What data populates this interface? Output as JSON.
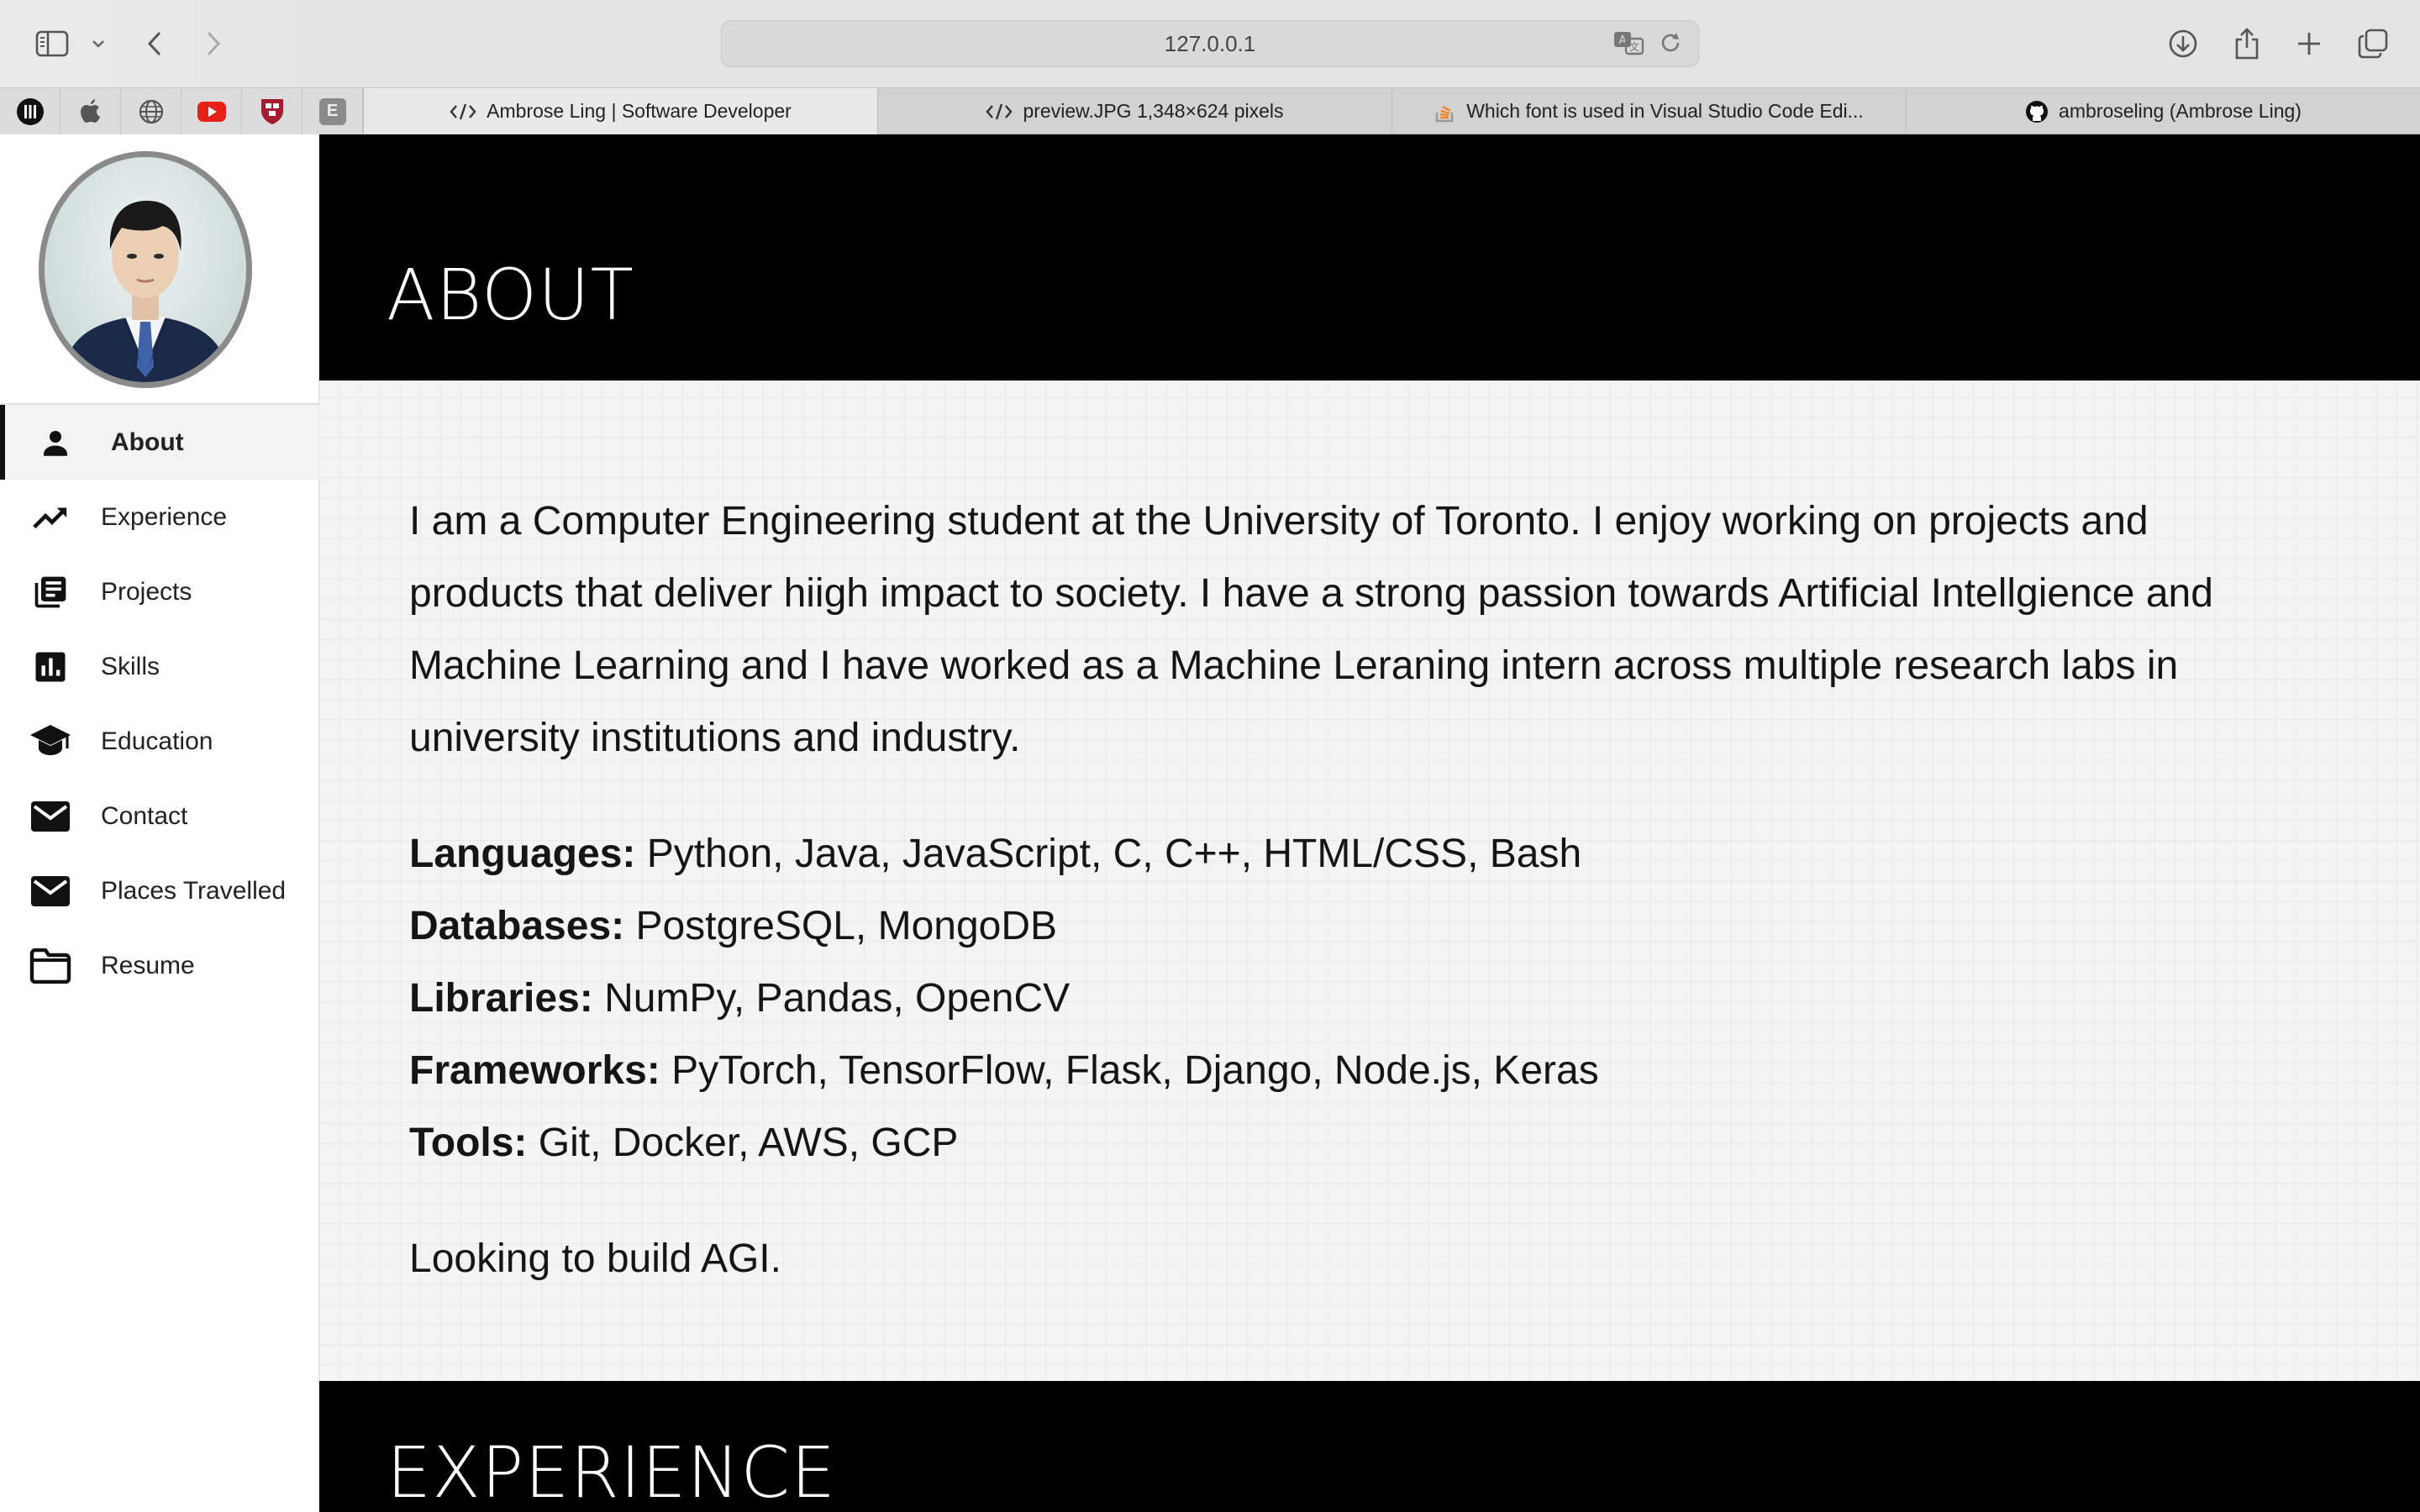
{
  "browser": {
    "url": "127.0.0.1",
    "tabs": [
      {
        "label": "Ambrose Ling | Software Developer",
        "icon": "code-icon",
        "active": true
      },
      {
        "label": "preview.JPG 1,348×624 pixels",
        "icon": "code-icon",
        "active": false
      },
      {
        "label": "Which font is used in Visual Studio Code Edi...",
        "icon": "stackoverflow-icon",
        "active": false
      },
      {
        "label": "ambroseling (Ambrose Ling)",
        "icon": "github-icon",
        "active": false
      }
    ],
    "favorites": [
      "podcast-icon",
      "apple-icon",
      "globe-icon",
      "youtube-icon",
      "harvard-shield-icon",
      "e-letter-icon"
    ],
    "favorite_letter": "E"
  },
  "sidebar": {
    "items": [
      {
        "label": "About",
        "icon": "person-icon",
        "active": true
      },
      {
        "label": "Experience",
        "icon": "trending-up-icon",
        "active": false
      },
      {
        "label": "Projects",
        "icon": "library-books-icon",
        "active": false
      },
      {
        "label": "Skills",
        "icon": "bar-chart-icon",
        "active": false
      },
      {
        "label": "Education",
        "icon": "graduation-cap-icon",
        "active": false
      },
      {
        "label": "Contact",
        "icon": "mail-icon",
        "active": false
      },
      {
        "label": "Places Travelled",
        "icon": "mail-icon",
        "active": false
      },
      {
        "label": "Resume",
        "icon": "folder-icon",
        "active": false
      }
    ]
  },
  "about": {
    "title": "ABOUT",
    "bio": "I am a Computer Engineering student at the University of Toronto. I enjoy working on projects and products that deliver hiigh impact to society. I have a strong passion towards Artificial Intellgience and Machine Learning and I have worked as a Machine Leraning intern across multiple research labs in university institutions and industry.",
    "skills": [
      {
        "label": "Languages:",
        "value": " Python, Java, JavaScript, C, C++, HTML/CSS, Bash"
      },
      {
        "label": "Databases:",
        "value": " PostgreSQL, MongoDB"
      },
      {
        "label": "Libraries:",
        "value": " NumPy, Pandas, OpenCV"
      },
      {
        "label": "Frameworks:",
        "value": " PyTorch, TensorFlow, Flask, Django, Node.js, Keras"
      },
      {
        "label": "Tools:",
        "value": " Git, Docker, AWS, GCP"
      }
    ],
    "tagline": "Looking to build AGI."
  },
  "experience": {
    "title": "EXPERIENCE"
  }
}
